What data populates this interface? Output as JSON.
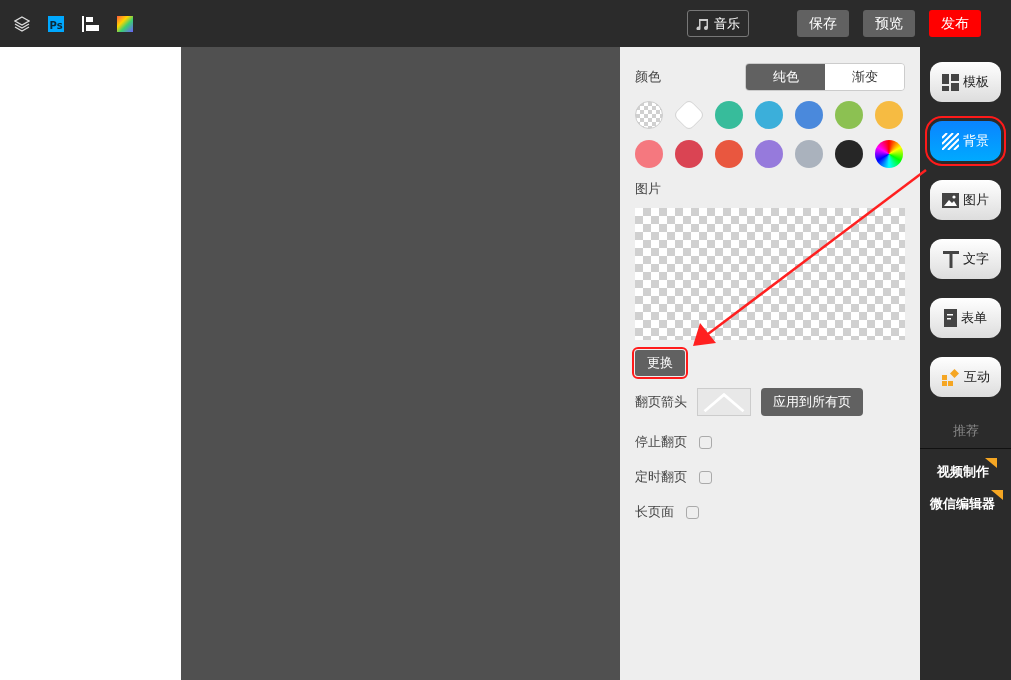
{
  "toolbar": {
    "tools": [
      {
        "kind": "layers"
      },
      {
        "kind": "ps",
        "label": "Ps"
      },
      {
        "kind": "align"
      },
      {
        "kind": "gradient"
      }
    ],
    "music_button": "音乐",
    "buttons": [
      {
        "label": "保存",
        "kind": "normal"
      },
      {
        "label": "预览",
        "kind": "normal"
      },
      {
        "label": "发布",
        "kind": "primary"
      }
    ]
  },
  "panel": {
    "color_label": "颜色",
    "tabs": [
      {
        "label": "纯色",
        "selected": true
      },
      {
        "label": "渐变",
        "selected": false
      }
    ],
    "swatches": [
      {
        "kind": "transparent"
      },
      {
        "kind": "white"
      },
      {
        "kind": "solid",
        "color": "#37bc9b"
      },
      {
        "kind": "solid",
        "color": "#3bafda"
      },
      {
        "kind": "solid",
        "color": "#4a89dc"
      },
      {
        "kind": "solid",
        "color": "#8cc152"
      },
      {
        "kind": "solid",
        "color": "#f6bb42"
      },
      {
        "kind": "solid",
        "color": "#f5787f"
      },
      {
        "kind": "solid",
        "color": "#da4453"
      },
      {
        "kind": "solid",
        "color": "#e9573f"
      },
      {
        "kind": "solid",
        "color": "#967adc"
      },
      {
        "kind": "solid",
        "color": "#aab2bd"
      },
      {
        "kind": "solid",
        "color": "#262626"
      },
      {
        "kind": "rainbow"
      }
    ],
    "image_label": "图片",
    "replace_button": {
      "label": "更换",
      "annotated": true
    },
    "arrow_label": "翻页箭头",
    "apply_button": "应用到所有页",
    "options": [
      {
        "label": "停止翻页",
        "checked": false
      },
      {
        "label": "定时翻页",
        "checked": false
      },
      {
        "label": "长页面",
        "checked": false
      }
    ]
  },
  "sidebar": {
    "items": [
      {
        "label": "模板",
        "selected": false,
        "annotated": false
      },
      {
        "label": "背景",
        "selected": true,
        "annotated": true
      },
      {
        "label": "图片",
        "selected": false,
        "annotated": false
      },
      {
        "label": "文字",
        "selected": false,
        "annotated": false
      },
      {
        "label": "表单",
        "selected": false,
        "annotated": false
      },
      {
        "label": "互动",
        "selected": false,
        "annotated": false
      }
    ],
    "recommend_label": "推荐",
    "links": [
      "视频制作",
      "微信编辑器"
    ]
  }
}
